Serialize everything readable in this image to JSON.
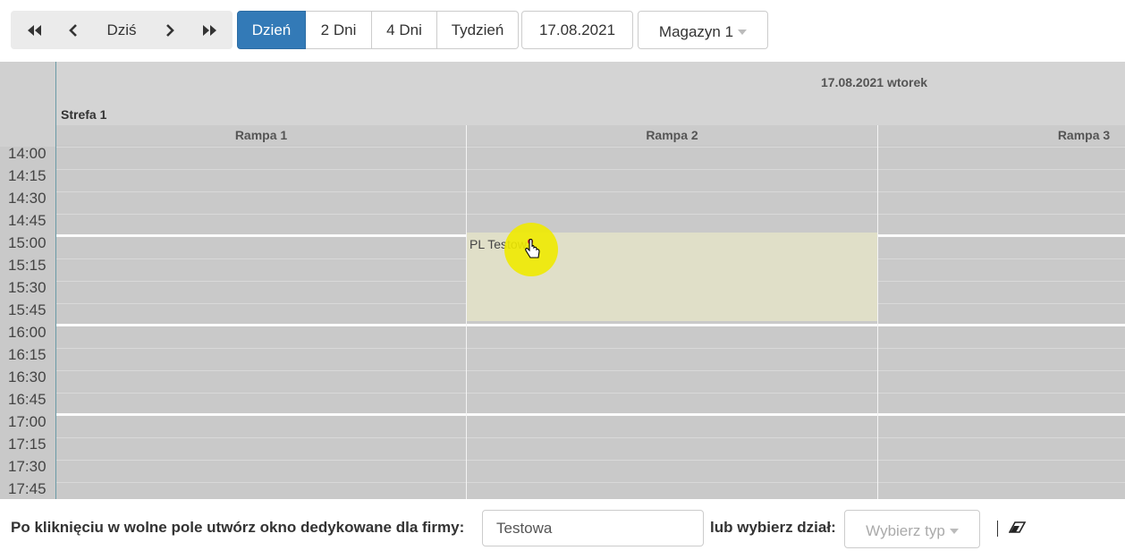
{
  "toolbar": {
    "nav": {
      "first_icon": "double-chevron-left-icon",
      "prev_icon": "chevron-left-icon",
      "today_label": "Dziś",
      "next_icon": "chevron-right-icon",
      "last_icon": "double-chevron-right-icon"
    },
    "views": [
      {
        "label": "Dzień",
        "active": true
      },
      {
        "label": "2 Dni",
        "active": false
      },
      {
        "label": "4 Dni",
        "active": false
      },
      {
        "label": "Tydzień",
        "active": false
      }
    ],
    "date": "17.08.2021",
    "warehouse": "Magazyn 1"
  },
  "calendar": {
    "day_header": "17.08.2021 wtorek",
    "zone": "Strefa 1",
    "ramps": [
      "Rampa 1",
      "Rampa 2",
      "Rampa 3"
    ],
    "times": [
      "14:00",
      "14:15",
      "14:30",
      "14:45",
      "15:00",
      "15:15",
      "15:30",
      "15:45",
      "16:00",
      "16:15",
      "16:30",
      "16:45",
      "17:00",
      "17:15",
      "17:30",
      "17:45"
    ],
    "event": {
      "label": "PL Testowa",
      "ramp": "Rampa 2",
      "start": "15:00",
      "end": "16:00"
    }
  },
  "footer": {
    "lead_text": "Po kliknięciu w wolne pole utwórz okno dedykowane dla firmy:",
    "firm_value": "Testowa",
    "or_text": "lub wybierz dział:",
    "type_placeholder": "Wybierz typ",
    "eraser_icon": "eraser-icon"
  },
  "colors": {
    "accent": "#337ab7",
    "grid_bg": "#c9c9c9",
    "event_bg": "#e0dfc8",
    "cursor_highlight": "#f0ea00"
  }
}
